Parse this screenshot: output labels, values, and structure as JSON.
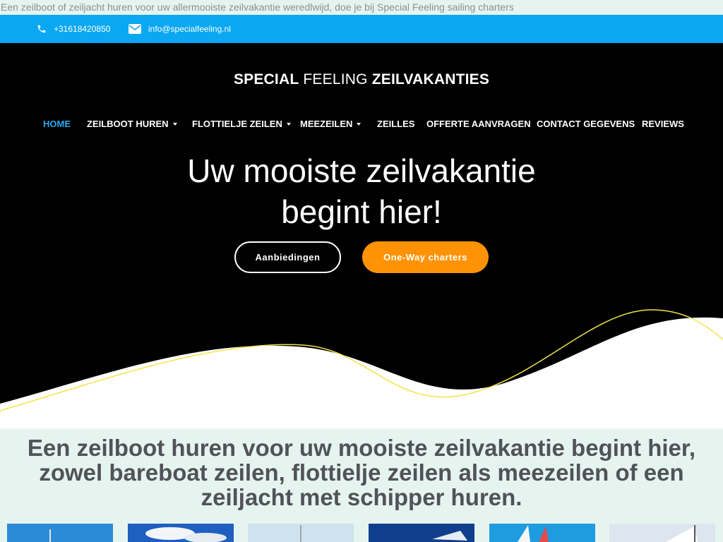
{
  "topline": "Een zeilboot of zeiljacht huren voor uw allermooiste zeilvakantie weredlwijd, doe je bij Special Feeling sailing charters",
  "infobar": {
    "phone": "+31618420850",
    "email": "info@specialfeeling.nl",
    "phone_icon": "phone-icon",
    "email_icon": "envelope-icon"
  },
  "logo": {
    "word1": "SPECIAL",
    "word2": "FEELING",
    "word3": "ZEILVAKANTIES"
  },
  "nav": {
    "items": [
      {
        "label": "HOME",
        "active": true
      },
      {
        "label": "ZEILBOOT HUREN",
        "dropdown": true
      },
      {
        "label": "FLOTTIELJE ZEILEN",
        "dropdown": true
      },
      {
        "label": "MEEZEILEN",
        "dropdown": true
      },
      {
        "label": "ZEILLES"
      },
      {
        "label": "OFFERTE AANVRAGEN"
      },
      {
        "label": "CONTACT GEGEVENS"
      },
      {
        "label": "REVIEWS"
      }
    ]
  },
  "hero": {
    "line1": "Uw mooiste zeilvakantie",
    "line2": "begint hier!",
    "button1": "Aanbiedingen",
    "button2": "One-Way charters"
  },
  "intro": {
    "line1": "Een zeilboot huren voor uw mooiste zeilvakantie begint hier,",
    "line2": "zowel bareboat zeilen, flottielje zeilen als meezeilen of een",
    "line3": "zeiljacht met schipper huren."
  },
  "colors": {
    "accent_blue": "#0aa7f3",
    "active_nav": "#2aa8ef",
    "orange": "#ff9205",
    "hero_bg": "#000000",
    "page_bg": "#e6f4ef",
    "wave_line": "#f2e34a"
  }
}
